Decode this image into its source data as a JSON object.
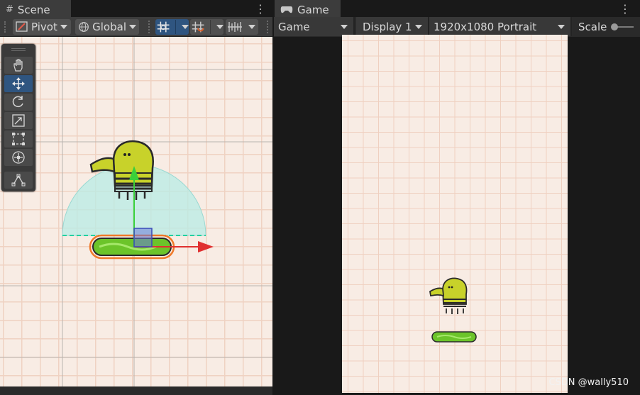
{
  "scene_panel": {
    "tab_label": "Scene",
    "pivot_label": "Pivot",
    "global_label": "Global"
  },
  "tools": [
    "hand-tool",
    "move-tool",
    "rotate-tool",
    "scale-tool",
    "rect-tool",
    "transform-tool",
    "custom-tool"
  ],
  "game_panel": {
    "tab_label": "Game",
    "view_select": "Game",
    "display_select": "Display 1",
    "resolution_select": "1920x1080 Portrait",
    "scale_label": "Scale"
  },
  "watermark": "CSDN @wally510",
  "colors": {
    "panel": "#3c3c3c",
    "accent": "#2f5580",
    "background": "#f8ece4",
    "grid": "#f0d2c2"
  }
}
